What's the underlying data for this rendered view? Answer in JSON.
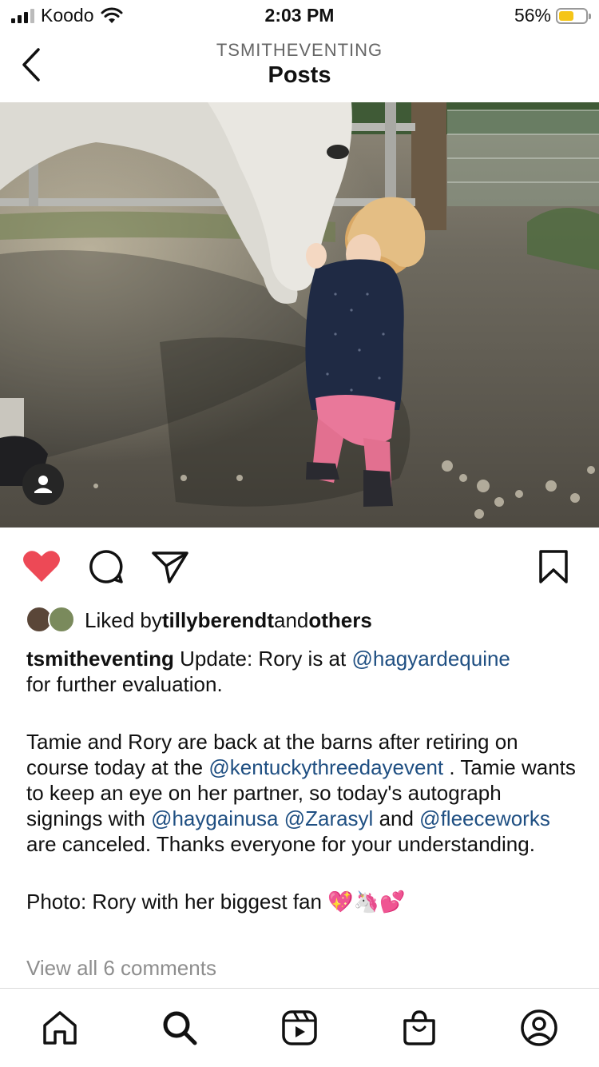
{
  "status_bar": {
    "carrier": "Koodo",
    "time": "2:03 PM",
    "battery_percent": "56%",
    "battery_level": 0.56
  },
  "header": {
    "account": "TSMITHEVENTING",
    "title": "Posts"
  },
  "post": {
    "liked_by_prefix": "Liked by ",
    "liked_by_user": "tillyberendt",
    "liked_by_and": " and ",
    "liked_by_others": "others",
    "caption": {
      "username": "tsmitheventing",
      "l1_text": " Update: Rory is at ",
      "l1_mention": "@hagyardequine",
      "l2_text": "for further evaluation.",
      "p2_a": "Tamie and Rory are back at the barns after retiring on course today at the ",
      "p2_m1": "@kentuckythreedayevent",
      "p2_b": " . Tamie wants to keep an eye on her partner, so today's autograph signings with ",
      "p2_m2": "@haygainusa",
      "p2_sp": " ",
      "p2_m3": "@Zarasyl",
      "p2_and": " and ",
      "p2_m4": "@fleeceworks",
      "p2_c": " are canceled. Thanks everyone for your understanding.",
      "p3": "Photo: Rory with her biggest fan 💖🦄💕"
    },
    "view_comments": "View all 6 comments"
  },
  "colors": {
    "like_red": "#ed4956",
    "mention_blue": "#1f4f82",
    "muted": "#8e8e8e"
  },
  "icons": {
    "actions": [
      "heart-icon",
      "comment-icon",
      "share-icon",
      "bookmark-icon"
    ],
    "tabs": [
      "home-icon",
      "search-icon",
      "reels-icon",
      "shop-icon",
      "profile-icon"
    ]
  }
}
